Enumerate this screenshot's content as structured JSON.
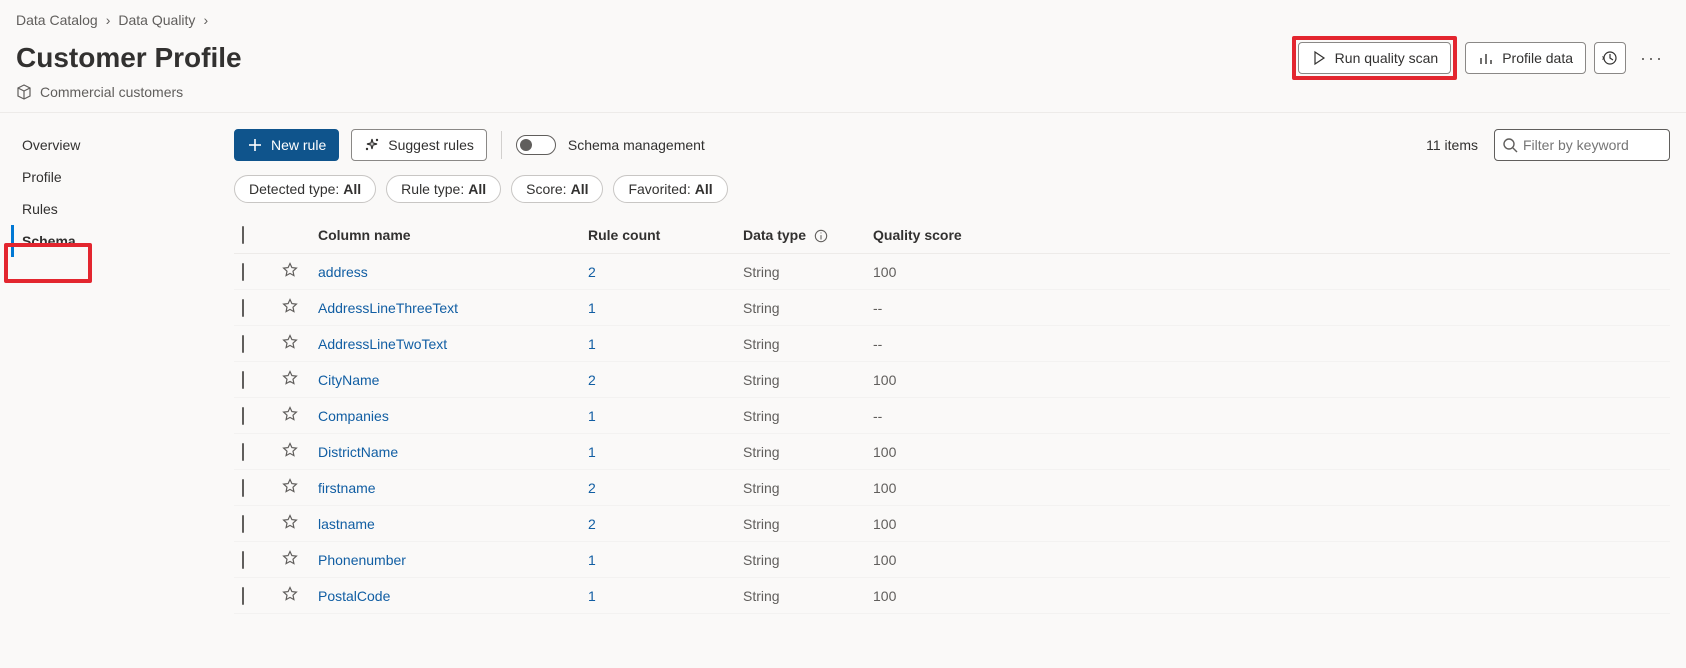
{
  "breadcrumb": {
    "items": [
      "Data Catalog",
      "Data Quality"
    ]
  },
  "header": {
    "title": "Customer Profile",
    "subtitle": "Commercial customers",
    "run_quality_scan": "Run quality scan",
    "profile_data": "Profile data"
  },
  "sidebar": {
    "items": [
      {
        "label": "Overview",
        "active": false
      },
      {
        "label": "Profile",
        "active": false
      },
      {
        "label": "Rules",
        "active": false
      },
      {
        "label": "Schema",
        "active": true
      }
    ]
  },
  "toolbar": {
    "new_rule": "New rule",
    "suggest_rules": "Suggest rules",
    "schema_mgmt": "Schema management",
    "item_count": "11 items",
    "filter_placeholder": "Filter by keyword"
  },
  "chips": {
    "detected_type_label": "Detected type:",
    "detected_type_value": "All",
    "rule_type_label": "Rule type:",
    "rule_type_value": "All",
    "score_label": "Score:",
    "score_value": "All",
    "favorited_label": "Favorited:",
    "favorited_value": "All"
  },
  "table": {
    "headers": {
      "column_name": "Column name",
      "rule_count": "Rule count",
      "data_type": "Data type",
      "quality_score": "Quality score"
    },
    "rows": [
      {
        "name": "address",
        "rule_count": "2",
        "data_type": "String",
        "score": "100"
      },
      {
        "name": "AddressLineThreeText",
        "rule_count": "1",
        "data_type": "String",
        "score": "--"
      },
      {
        "name": "AddressLineTwoText",
        "rule_count": "1",
        "data_type": "String",
        "score": "--"
      },
      {
        "name": "CityName",
        "rule_count": "2",
        "data_type": "String",
        "score": "100"
      },
      {
        "name": "Companies",
        "rule_count": "1",
        "data_type": "String",
        "score": "--"
      },
      {
        "name": "DistrictName",
        "rule_count": "1",
        "data_type": "String",
        "score": "100"
      },
      {
        "name": "firstname",
        "rule_count": "2",
        "data_type": "String",
        "score": "100"
      },
      {
        "name": "lastname",
        "rule_count": "2",
        "data_type": "String",
        "score": "100"
      },
      {
        "name": "Phonenumber",
        "rule_count": "1",
        "data_type": "String",
        "score": "100"
      },
      {
        "name": "PostalCode",
        "rule_count": "1",
        "data_type": "String",
        "score": "100"
      }
    ]
  }
}
